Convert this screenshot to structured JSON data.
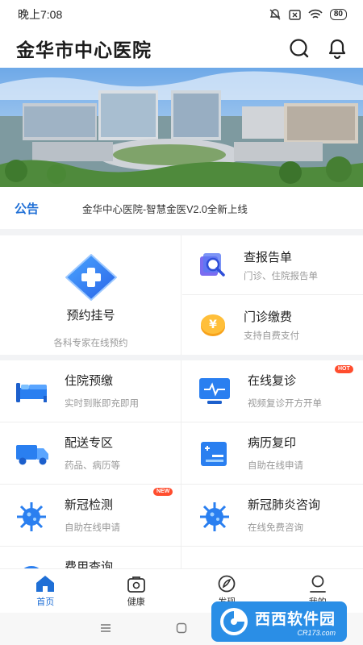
{
  "status_bar": {
    "time": "晚上7:08",
    "battery": "80"
  },
  "header": {
    "title": "金华市中心医院",
    "search_icon": "search-icon",
    "bell_icon": "bell-icon"
  },
  "notice": {
    "tag": "公告",
    "text": "金华中心医院-智慧金医V2.0全新上线"
  },
  "feature": {
    "main": {
      "label": "预约挂号",
      "sub": "各科专家在线预约",
      "icon": "plus-diamond-icon"
    },
    "right": [
      {
        "title": "查报告单",
        "sub": "门诊、住院报告单",
        "icon": "report-search-icon"
      },
      {
        "title": "门诊缴费",
        "sub": "支持自费支付",
        "icon": "yen-coin-icon"
      }
    ]
  },
  "services": [
    {
      "title": "住院预缴",
      "sub": "实时到账即充即用",
      "icon": "hospital-bed-icon"
    },
    {
      "title": "在线复诊",
      "sub": "视频复诊开方开单",
      "icon": "monitor-icon",
      "badge": "HOT"
    },
    {
      "title": "配送专区",
      "sub": "药品、病历等",
      "icon": "truck-icon"
    },
    {
      "title": "病历复印",
      "sub": "自助在线申请",
      "icon": "record-copy-icon"
    },
    {
      "title": "新冠检测",
      "sub": "自助在线申请",
      "icon": "virus-icon",
      "badge": "NEW"
    },
    {
      "title": "新冠肺炎咨询",
      "sub": "在线免费咨询",
      "icon": "virus-icon"
    },
    {
      "title": "费用查询",
      "sub": "",
      "icon": "fee-icon"
    }
  ],
  "tabs": [
    {
      "label": "首页",
      "icon": "home-icon",
      "active": true
    },
    {
      "label": "健康",
      "icon": "health-bag-icon",
      "active": false
    },
    {
      "label": "发现",
      "icon": "discover-icon",
      "active": false
    },
    {
      "label": "我的",
      "icon": "user-icon",
      "active": false
    }
  ],
  "watermark": {
    "text": "西西软件园",
    "sub": "CR173.com"
  },
  "colors": {
    "accent": "#1f6fd6",
    "badge": "#ff4d2e",
    "icon_blue": "#2a7ff0"
  }
}
